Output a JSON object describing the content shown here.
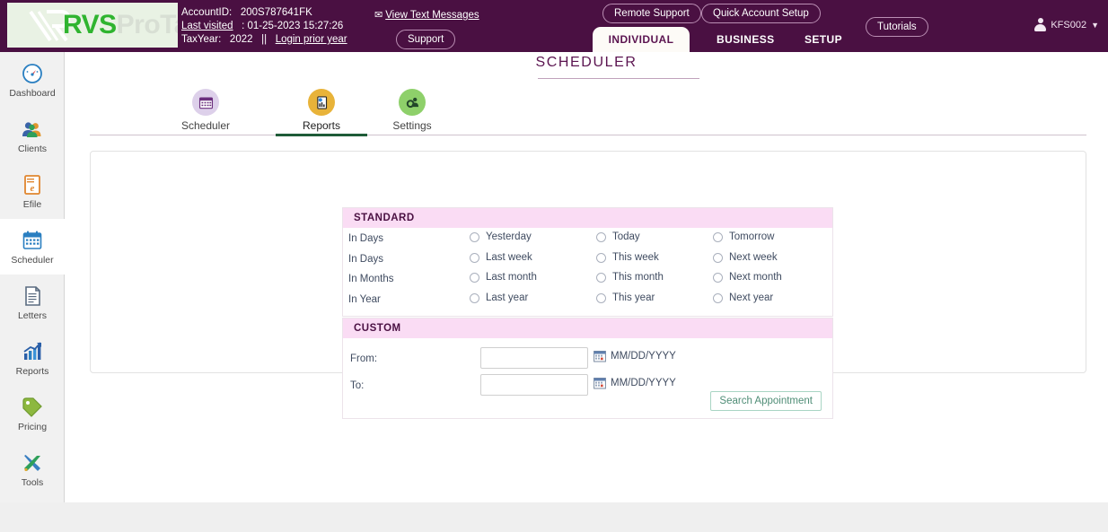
{
  "brand": {
    "logo_primary": "RVS",
    "logo_secondary": "ProTax",
    "logo_mark_icon": "rvs-monogram-icon"
  },
  "header": {
    "account_id_label": "AccountID:",
    "account_id_value": "200S787641FK",
    "last_visited_label": "Last visited",
    "last_visited_value": ": 01-25-2023 15:27:26",
    "tax_year_label": "TaxYear:",
    "tax_year_value": "2022",
    "separator": "||",
    "login_prior_year": "Login prior year",
    "view_text_messages": "View Text Messages",
    "mail_icon": "envelope-icon",
    "support_button": "Support",
    "remote_support_button": "Remote Support",
    "quick_account_setup_button": "Quick Account Setup",
    "tutorials_button": "Tutorials",
    "user_name": "KFS002",
    "user_icon": "user-avatar-icon",
    "caret_icon": "caret-down-icon",
    "bg_color": "#4a1042",
    "nav_tabs": [
      {
        "label": "INDIVIDUAL",
        "active": true
      },
      {
        "label": "BUSINESS",
        "active": false
      },
      {
        "label": "SETUP",
        "active": false
      }
    ]
  },
  "sidebar": {
    "items": [
      {
        "label": "Dashboard",
        "icon": "speedometer-icon",
        "active": false
      },
      {
        "label": "Clients",
        "icon": "people-icon",
        "active": false
      },
      {
        "label": "Efile",
        "icon": "efile-document-icon",
        "active": false
      },
      {
        "label": "Scheduler",
        "icon": "calendar-icon",
        "active": true
      },
      {
        "label": "Letters",
        "icon": "letter-page-icon",
        "active": false
      },
      {
        "label": "Reports",
        "icon": "bar-chart-arrow-icon",
        "active": false
      },
      {
        "label": "Pricing",
        "icon": "price-tag-icon",
        "active": false
      },
      {
        "label": "Tools",
        "icon": "wrench-screwdriver-icon",
        "active": false
      }
    ]
  },
  "main": {
    "page_title": "SCHEDULER",
    "accent_color": "#5b1450",
    "active_underline_color": "#1f5c38",
    "sub_tabs": [
      {
        "label": "Scheduler",
        "icon": "calendar-icon",
        "active": false
      },
      {
        "label": "Reports",
        "icon": "report-doc-icon",
        "active": true
      },
      {
        "label": "Settings",
        "icon": "gear-person-icon",
        "active": false
      }
    ],
    "standard_panel": {
      "title": "STANDARD",
      "header_color": "#fadcf4",
      "rows": [
        {
          "label": "In Days",
          "options": [
            "Yesterday",
            "Today",
            "Tomorrow"
          ]
        },
        {
          "label": "In Days",
          "options": [
            "Last week",
            "This week",
            "Next week"
          ]
        },
        {
          "label": "In Months",
          "options": [
            "Last month",
            "This month",
            "Next month"
          ]
        },
        {
          "label": "In Year",
          "options": [
            "Last year",
            "This year",
            "Next year"
          ]
        }
      ]
    },
    "custom_panel": {
      "title": "CUSTOM",
      "header_color": "#fadcf4",
      "from_label": "From:",
      "from_value": "",
      "from_placeholder": "",
      "to_label": "To:",
      "to_value": "",
      "to_placeholder": "",
      "date_format_hint": "MM/DD/YYYY",
      "calendar_icon": "calendar-picker-icon",
      "search_button": "Search Appointment",
      "search_button_color": "#4f8d76"
    }
  }
}
